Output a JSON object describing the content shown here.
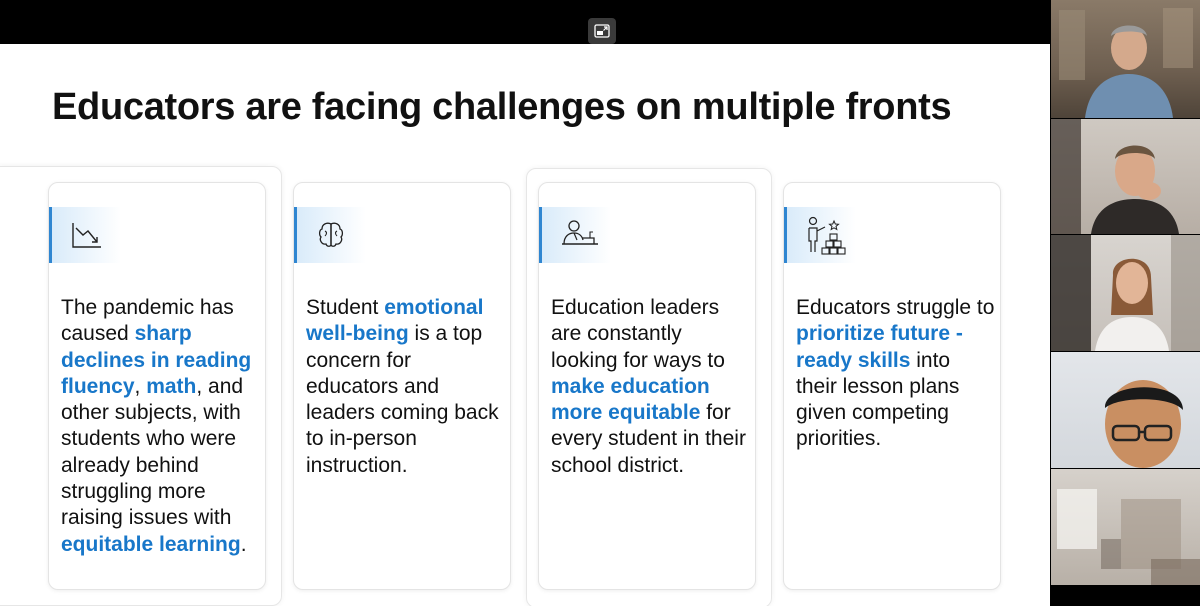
{
  "slide": {
    "title": "Educators are facing challenges on multiple fronts"
  },
  "cards": [
    {
      "icon": "declining-chart-icon",
      "text": [
        {
          "t": "The pandemic has caused "
        },
        {
          "t": "sharp declines in reading fluency",
          "h": true
        },
        {
          "t": ", "
        },
        {
          "t": "math",
          "h": true
        },
        {
          "t": ", and other subjects, with students who were already behind struggling more raising issues with "
        },
        {
          "t": "equitable learning",
          "h": true
        },
        {
          "t": "."
        }
      ]
    },
    {
      "icon": "brain-icon",
      "text": [
        {
          "t": "Student "
        },
        {
          "t": "emotional well-being",
          "h": true
        },
        {
          "t": " is a top concern for educators and leaders coming back to in-person instruction."
        }
      ]
    },
    {
      "icon": "presenter-podium-icon",
      "text": [
        {
          "t": "Education leaders are constantly looking for ways to "
        },
        {
          "t": "make education more equitable",
          "h": true
        },
        {
          "t": " for every student in their school district."
        }
      ]
    },
    {
      "icon": "teacher-blocks-icon",
      "text": [
        {
          "t": "Educators struggle to "
        },
        {
          "t": "prioritize future -ready skills",
          "h": true
        },
        {
          "t": " into their lesson plans given competing priorities."
        }
      ]
    }
  ],
  "toolbar": {
    "popout_icon": "pop-out-icon"
  },
  "participants": [
    {
      "name_icon": "participant-video-1"
    },
    {
      "name_icon": "participant-video-2"
    },
    {
      "name_icon": "participant-video-3"
    },
    {
      "name_icon": "participant-video-4"
    },
    {
      "name_icon": "participant-video-5"
    }
  ],
  "colors": {
    "accent": "#1877c9",
    "icon_bar": "#2f86d1"
  }
}
